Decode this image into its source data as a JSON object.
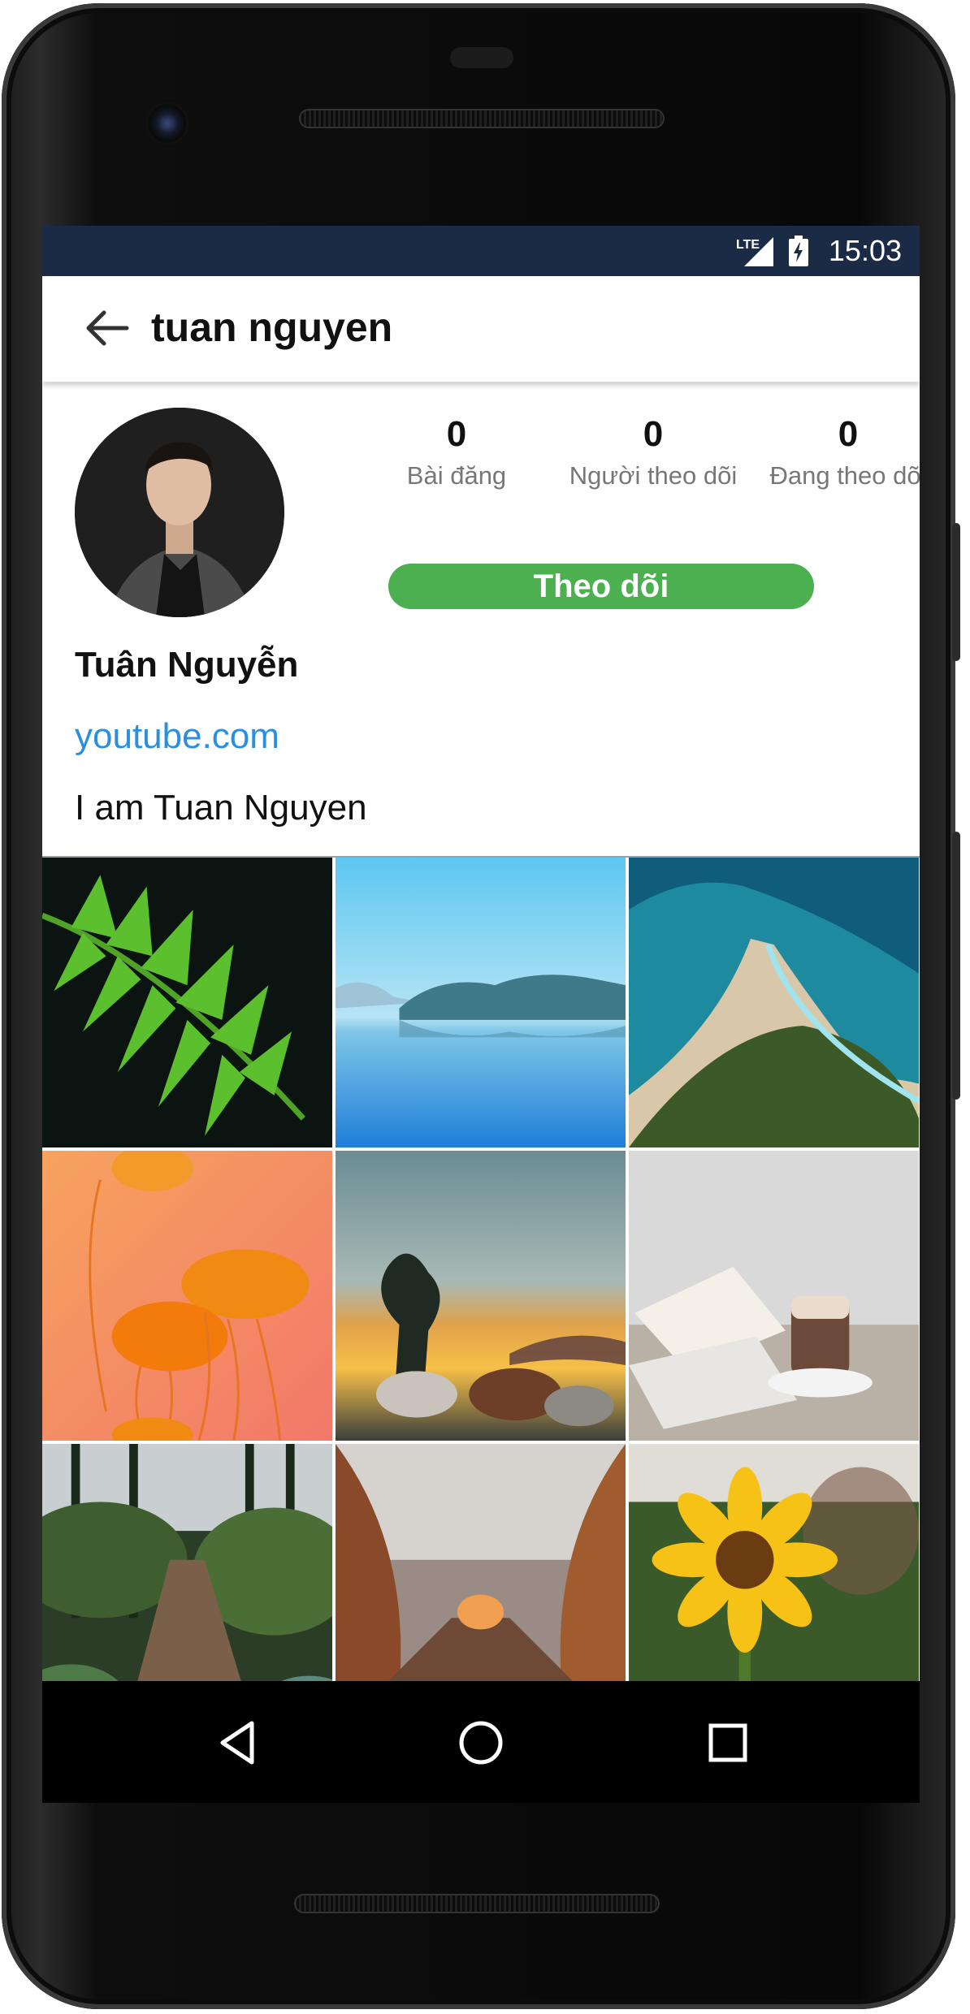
{
  "status_bar": {
    "network": "LTE",
    "time": "15:03"
  },
  "app_bar": {
    "title": "tuan nguyen",
    "back_icon": "arrow-back-icon"
  },
  "profile": {
    "display_name": "Tuân Nguyễn",
    "website": "youtube.com",
    "bio": "I am Tuan Nguyen",
    "stats": [
      {
        "value": "0",
        "label": "Bài đăng"
      },
      {
        "value": "0",
        "label": "Người theo dõi"
      },
      {
        "value": "0",
        "label": "Đang theo dõi"
      }
    ],
    "follow_button": "Theo dõi",
    "follow_button_color": "#4caf50",
    "link_color": "#2b8fe0"
  },
  "photo_grid": {
    "items": [
      {
        "subject": "fern"
      },
      {
        "subject": "lake"
      },
      {
        "subject": "beach"
      },
      {
        "subject": "jellyfish"
      },
      {
        "subject": "horses-sunset"
      },
      {
        "subject": "coffee-book"
      },
      {
        "subject": "forest-bridge"
      },
      {
        "subject": "autumn-path"
      },
      {
        "subject": "sunflower"
      }
    ]
  },
  "nav_bar": {
    "icons": [
      "back-triangle-icon",
      "home-circle-icon",
      "recents-square-icon"
    ]
  },
  "colors": {
    "status_bar": "#1b2a45",
    "accent": "#4caf50"
  }
}
